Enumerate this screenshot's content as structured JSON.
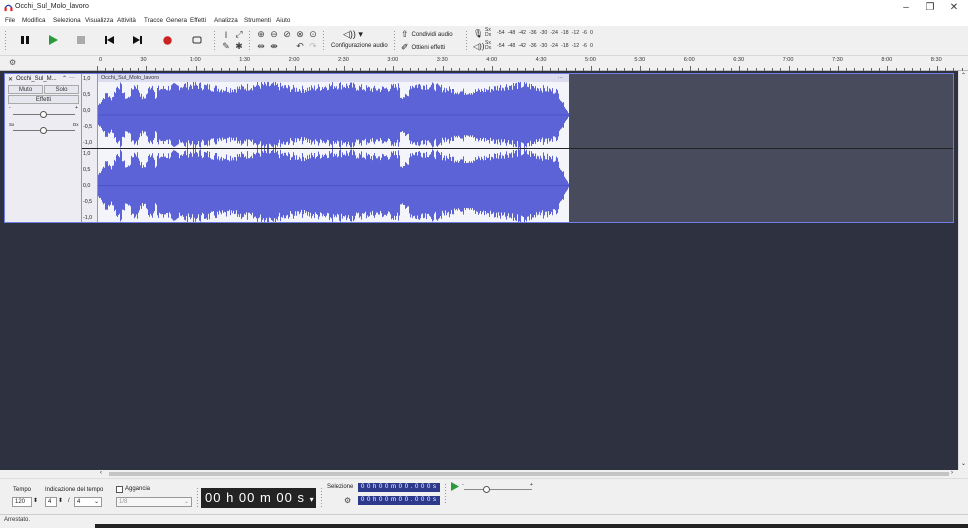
{
  "window": {
    "title": "Occhi_Sul_Molo_lavoro",
    "controls": [
      "–",
      "❐",
      "✕"
    ]
  },
  "menu": [
    "File",
    "Modifica",
    "Seleziona",
    "Visualizza",
    "Attività",
    "Tracce",
    "Genera",
    "Effetti",
    "Analizza",
    "Strumenti",
    "Aiuto"
  ],
  "toolbar": {
    "audio_setup_label": "Configurazione audio",
    "share_audio_label": "Condividi audio",
    "get_effects_label": "Ottieni effetti",
    "meter_rec_label": "Sx Dx",
    "meter_play_label": "Sx Dx",
    "meter_scale": [
      "-54",
      "-48",
      "-42",
      "-36",
      "-30",
      "-24",
      "-18",
      "-12",
      "-6",
      "0"
    ]
  },
  "ruler": {
    "ticks": [
      "0",
      "30",
      "1:00",
      "1:30",
      "2:00",
      "2:30",
      "3:00",
      "3:30",
      "4:00",
      "4:30",
      "5:00",
      "5:30",
      "6:00",
      "6:30",
      "7:00",
      "7:30",
      "8:00",
      "8:30"
    ]
  },
  "track": {
    "name": "Occhi_Sul_M...",
    "mute_label": "Muto",
    "solo_label": "Solo",
    "effects_label": "Effetti",
    "gain_minus": "-",
    "gain_plus": "+",
    "pan_left": "Sx",
    "pan_right": "Dx",
    "clip_name": "Occhi_Sul_Molo_lavoro",
    "clip_menu": "···",
    "scale_top": [
      "1,0",
      "0,5",
      "0,0",
      "-0,5",
      "-1,0"
    ],
    "scale_bottom": [
      "1,0",
      "0,5",
      "0,0",
      "-0,5",
      "-1,0"
    ],
    "waveform_color": "#5b63d6"
  },
  "bottom": {
    "tempo_label": "Tempo",
    "tempo_value": "120",
    "time_sig_label": "Indicazione del tempo",
    "time_sig_num": "4",
    "time_sig_den": "4",
    "snap_label": "Aggancia",
    "snap_value": "1/8",
    "time_display": "00 h 00 m 00 s",
    "selection_label": "Selezione",
    "sel_start": "0 0 h 0 0 m 0 0 . 0 0 0 s",
    "sel_end": "0 0 h 0 0 m 0 0 . 0 0 0 s"
  },
  "status": {
    "text": "Arrestato."
  }
}
